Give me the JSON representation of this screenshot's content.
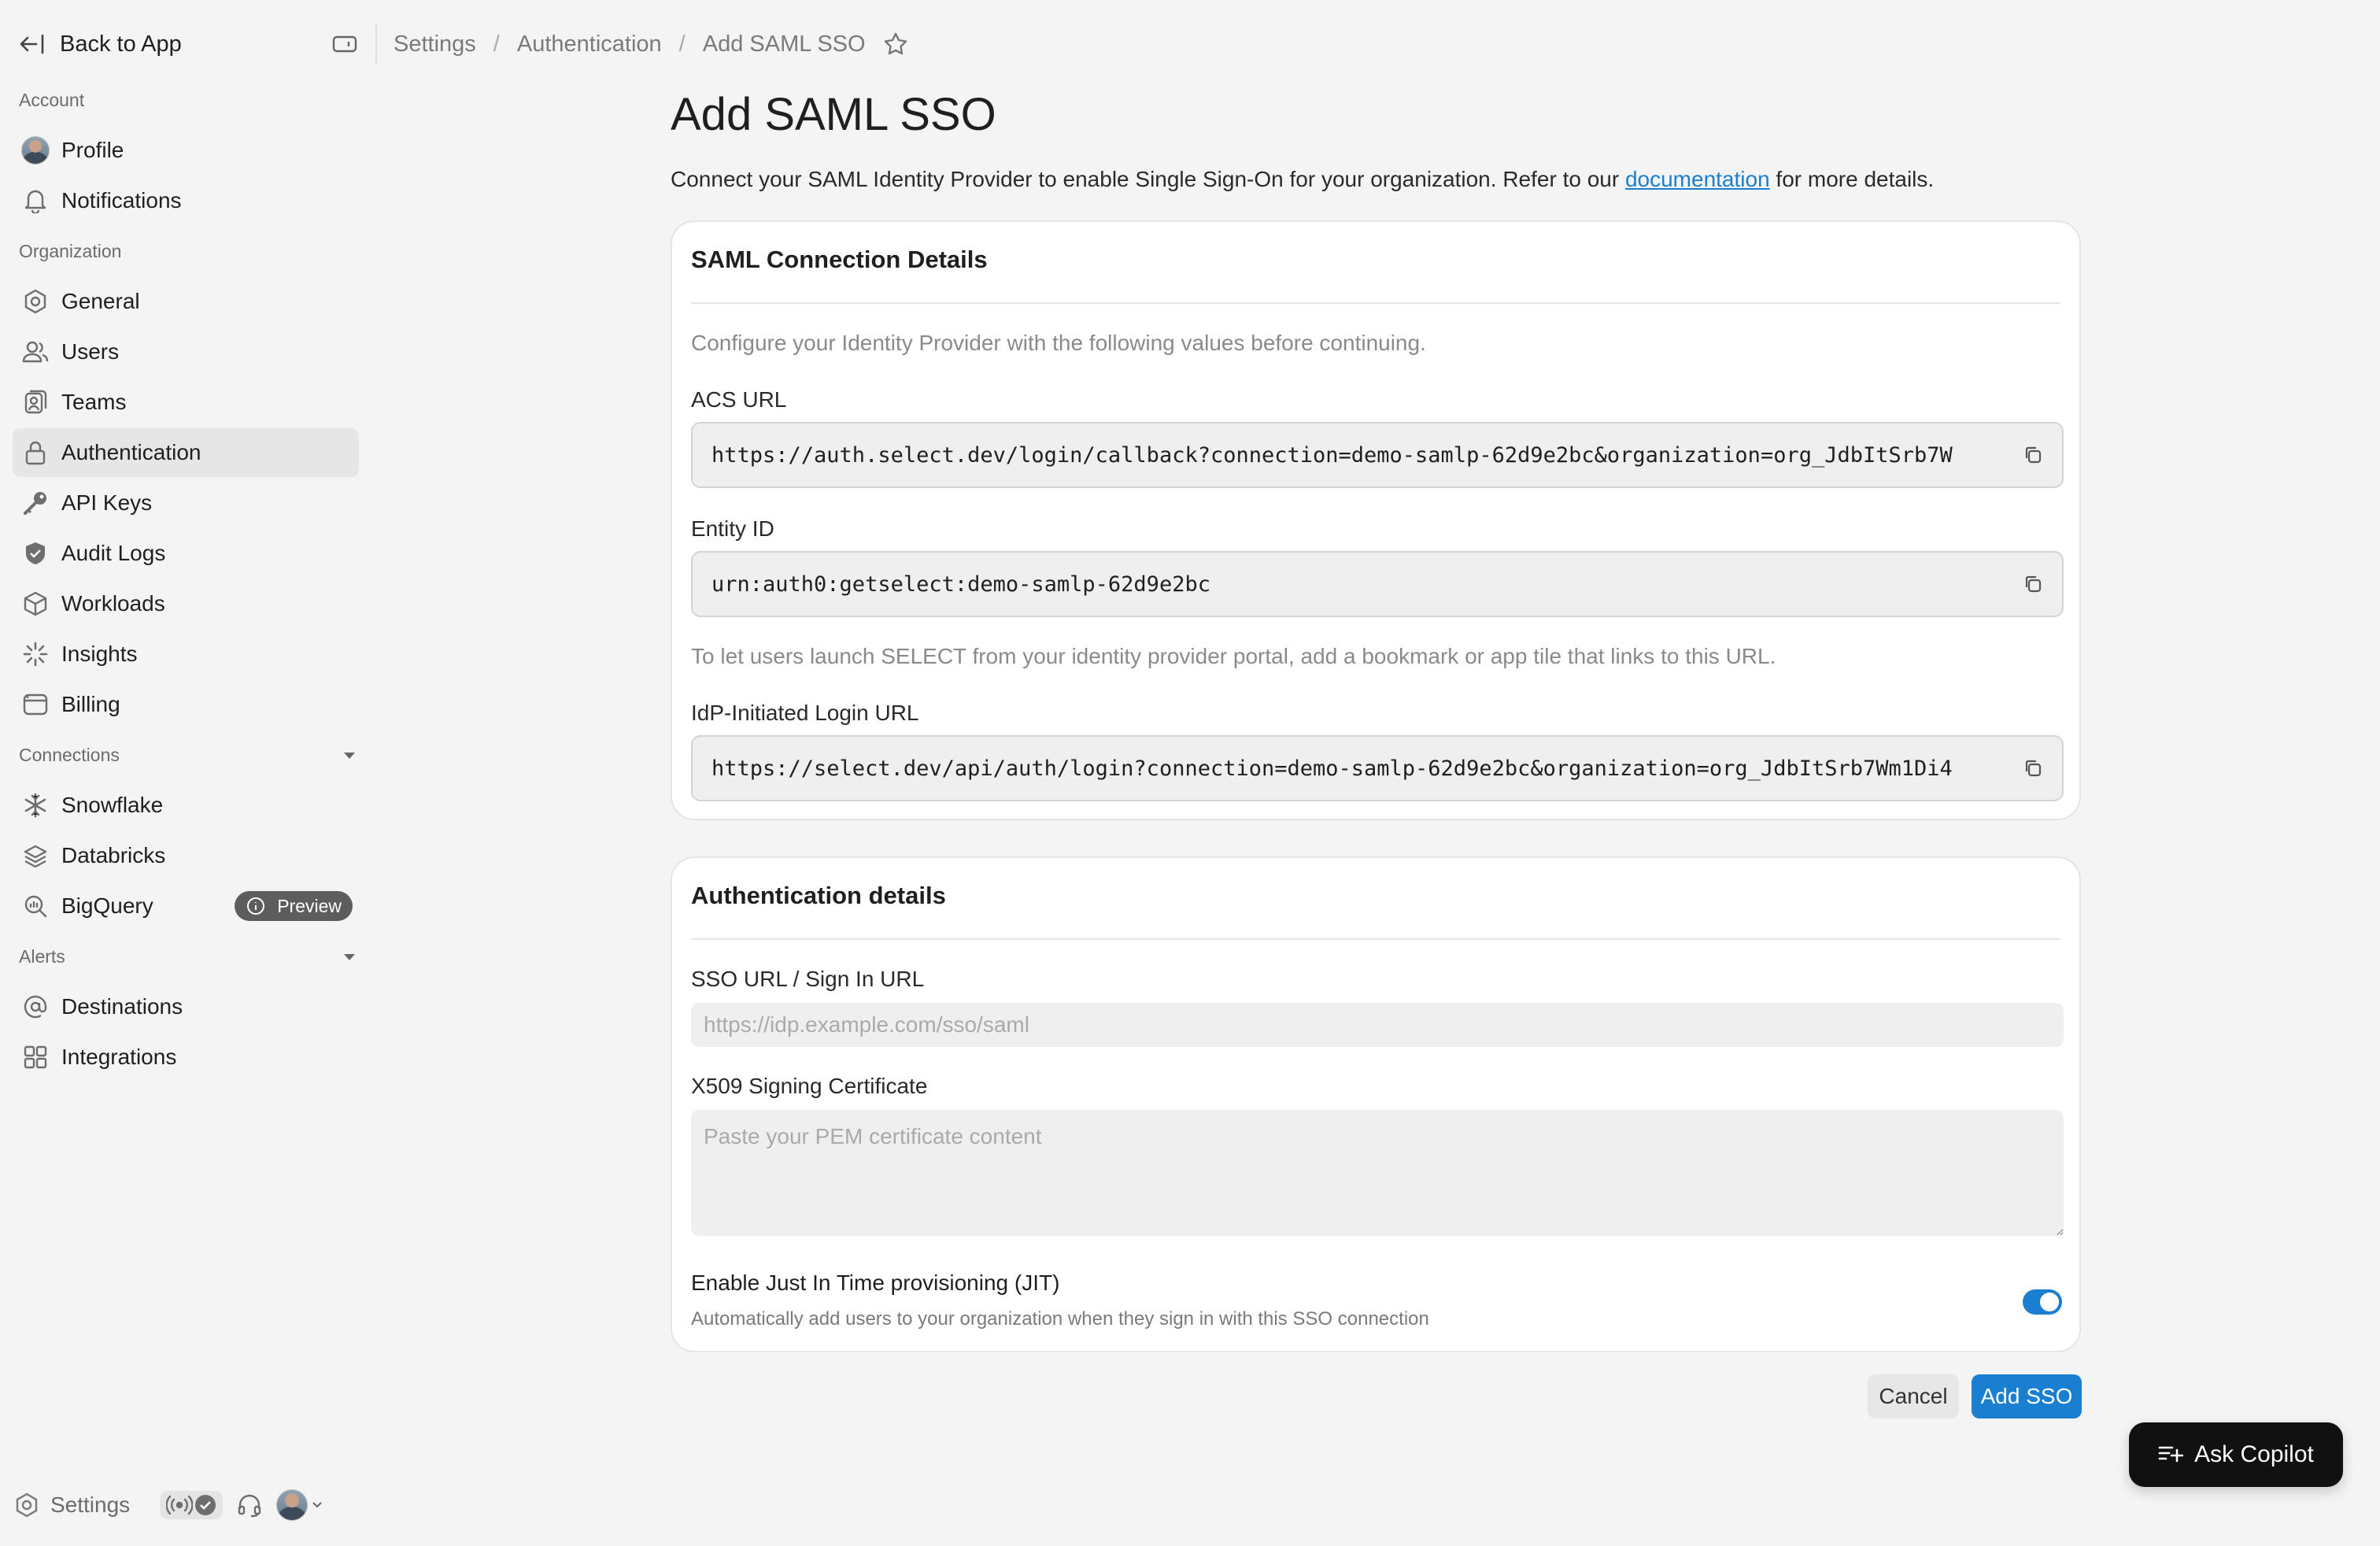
{
  "sidebar": {
    "back_label": "Back to App",
    "sections": {
      "account": "Account",
      "organization": "Organization",
      "connections": "Connections",
      "alerts": "Alerts"
    },
    "items": {
      "profile": "Profile",
      "notifications": "Notifications",
      "general": "General",
      "users": "Users",
      "teams": "Teams",
      "authentication": "Authentication",
      "api_keys": "API Keys",
      "audit_logs": "Audit Logs",
      "workloads": "Workloads",
      "insights": "Insights",
      "billing": "Billing",
      "snowflake": "Snowflake",
      "databricks": "Databricks",
      "bigquery": "BigQuery",
      "destinations": "Destinations",
      "integrations": "Integrations"
    },
    "active_item": "authentication",
    "preview_badge": "Preview",
    "footer_settings": "Settings"
  },
  "breadcrumb": [
    "Settings",
    "Authentication",
    "Add SAML SSO"
  ],
  "page": {
    "title": "Add SAML SSO",
    "desc_before": "Connect your SAML Identity Provider to enable Single Sign-On for your organization. Refer to our ",
    "desc_link": "documentation",
    "desc_after": " for more details."
  },
  "connection_card": {
    "title": "SAML Connection Details",
    "intro": "Configure your Identity Provider with the following values before continuing.",
    "acs_label": "ACS URL",
    "acs_value": "https://auth.select.dev/login/callback?connection=demo-samlp-62d9e2bc&organization=org_JdbItSrb7W",
    "entity_label": "Entity ID",
    "entity_value": "urn:auth0:getselect:demo-samlp-62d9e2bc",
    "idp_help": "To let users launch SELECT from your identity provider portal, add a bookmark or app tile that links to this URL.",
    "idp_label": "IdP-Initiated Login URL",
    "idp_value": "https://select.dev/api/auth/login?connection=demo-samlp-62d9e2bc&organization=org_JdbItSrb7Wm1Di4"
  },
  "auth_card": {
    "title": "Authentication details",
    "sso_label": "SSO URL / Sign In URL",
    "sso_placeholder": "https://idp.example.com/sso/saml",
    "sso_value": "",
    "cert_label": "X509 Signing Certificate",
    "cert_placeholder": "Paste your PEM certificate content",
    "jit_title": "Enable Just In Time provisioning (JIT)",
    "jit_sub": "Automatically add users to your organization when they sign in with this SSO connection",
    "jit_enabled": true
  },
  "actions": {
    "cancel": "Cancel",
    "submit": "Add SSO"
  },
  "copilot_label": "Ask Copilot",
  "colors": {
    "accent": "#1a7fd1",
    "background": "#f4f4f4",
    "card": "#ffffff"
  }
}
